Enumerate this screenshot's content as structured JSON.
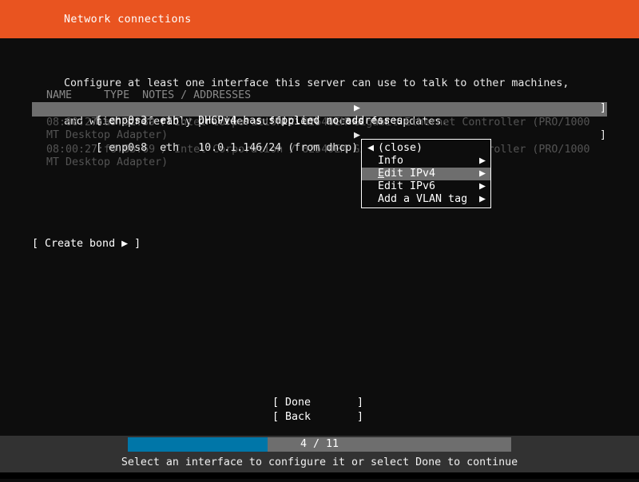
{
  "header": {
    "title": "Network connections",
    "bg": "#e95420"
  },
  "intro": {
    "line1": "Configure at least one interface this server can use to talk to other machines,",
    "line2": "and which preferably provides sufficient access for updates."
  },
  "table": {
    "headers": "NAME     TYPE  NOTES / ADDRESSES",
    "rows": [
      {
        "name": "enp0s3",
        "type": "eth",
        "notes": "DHCPv4 has supplied no addresses",
        "main": " enp0s3  eth   DHCPv4 has supplied no addresses",
        "detail1": "08:00:27:a9:51:39 / Intel Corporation / 82540EM Gigabit Ethernet Controller (PRO/1000",
        "detail2": "MT Desktop Adapter)",
        "bracket_open": "[",
        "bracket_close": "]",
        "arrow": "▶",
        "selected": true
      },
      {
        "name": "enp0s8",
        "type": "eth",
        "notes": "10.0.1.146/24 (from dhcp)",
        "main": " enp0s8  eth   10.0.1.146/24 (from dhcp)",
        "detail1": "08:00:27:f8:8b:69 / Intel Corporation / 82540EM Gigabit Ethernet Controller (PRO/1000",
        "detail2": "MT Desktop Adapter)",
        "bracket_open": "[",
        "bracket_close": "]",
        "arrow": "▶",
        "selected": false
      }
    ]
  },
  "menu": {
    "items": [
      {
        "left": "◀",
        "label": "(close)",
        "arrow": "",
        "selected": false,
        "mnemonic": ""
      },
      {
        "left": "",
        "label": "Info",
        "arrow": "▶",
        "selected": false,
        "mnemonic": ""
      },
      {
        "left": "",
        "label_mnemonic": "E",
        "label_rest": "dit IPv4",
        "label": "Edit IPv4",
        "arrow": "▶",
        "selected": true
      },
      {
        "left": "",
        "label": "Edit IPv6",
        "arrow": "▶",
        "selected": false,
        "mnemonic": ""
      },
      {
        "left": "",
        "label": "Add a VLAN tag",
        "arrow": "▶",
        "selected": false,
        "mnemonic": ""
      }
    ]
  },
  "create_bond": {
    "text": "[ Create bond ▶ ]",
    "label": "Create bond"
  },
  "buttons": {
    "done": {
      "open": "[",
      "label": "Done",
      "close": "]"
    },
    "back": {
      "open": "[",
      "label": "Back",
      "close": "]"
    }
  },
  "footer": {
    "progress_label": "4 / 11",
    "progress_current": 4,
    "progress_total": 11,
    "progress_fill_color": "#0076a8",
    "progress_track_color": "#6e6e6e",
    "hint": "Select an interface to configure it or select Done to continue"
  }
}
